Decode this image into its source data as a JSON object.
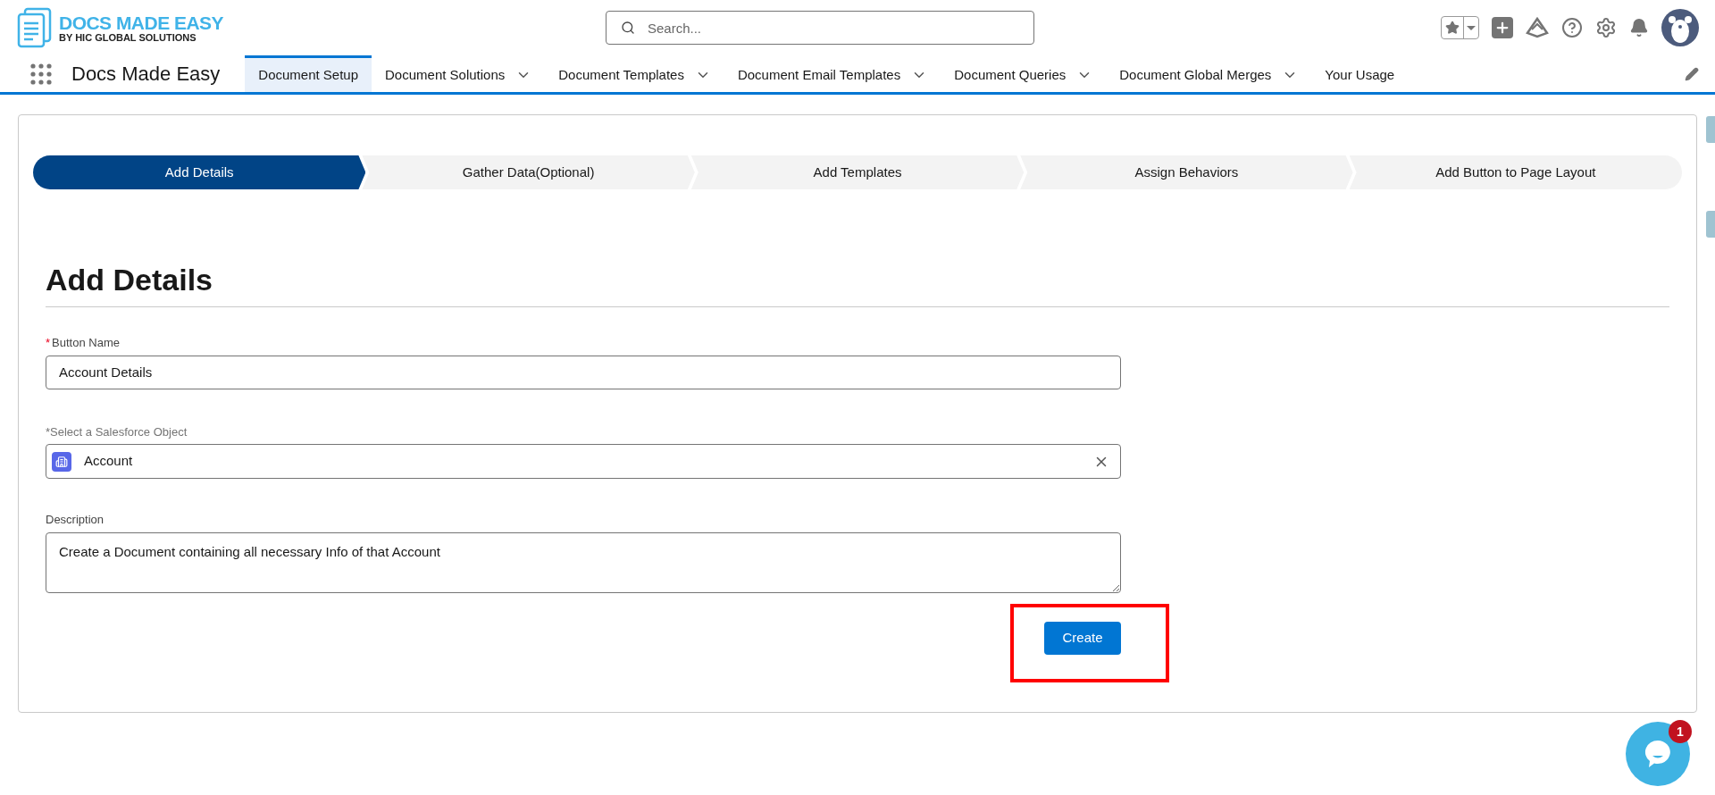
{
  "brand": {
    "title": "DOCS MADE EASY",
    "subtitle": "BY HIC GLOBAL SOLUTIONS"
  },
  "search": {
    "placeholder": "Search..."
  },
  "app_name": "Docs Made Easy",
  "nav_tabs": [
    {
      "label": "Document Setup",
      "selected": true,
      "dropdown": false
    },
    {
      "label": "Document Solutions",
      "selected": false,
      "dropdown": true
    },
    {
      "label": "Document Templates",
      "selected": false,
      "dropdown": true
    },
    {
      "label": "Document Email Templates",
      "selected": false,
      "dropdown": true
    },
    {
      "label": "Document Queries",
      "selected": false,
      "dropdown": true
    },
    {
      "label": "Document Global Merges",
      "selected": false,
      "dropdown": true
    },
    {
      "label": "Your Usage",
      "selected": false,
      "dropdown": false
    }
  ],
  "steps": [
    {
      "label": "Add Details",
      "selected": true
    },
    {
      "label": "Gather Data(Optional)",
      "selected": false
    },
    {
      "label": "Add Templates",
      "selected": false
    },
    {
      "label": "Assign Behaviors",
      "selected": false
    },
    {
      "label": "Add Button to Page Layout",
      "selected": false
    }
  ],
  "heading": "Add Details",
  "form": {
    "button_name": {
      "required_mark": "*",
      "label": "Button Name",
      "value": "Account Details"
    },
    "object": {
      "label": "*Select a Salesforce Object",
      "value": "Account"
    },
    "description": {
      "label": "Description",
      "value": "Create a Document containing all necessary Info of that Account"
    },
    "submit": "Create"
  },
  "chat": {
    "badge": "1"
  }
}
